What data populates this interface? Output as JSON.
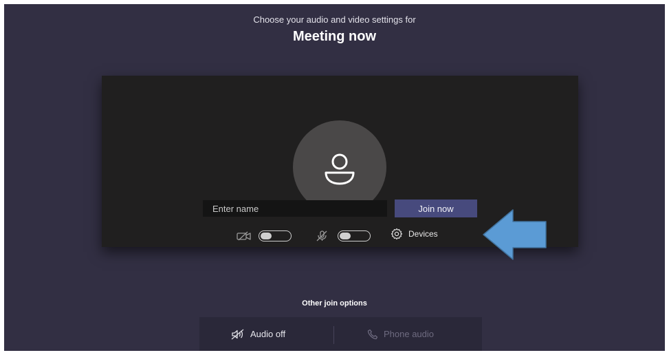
{
  "header": {
    "subtitle": "Choose your audio and video settings for",
    "title": "Meeting now"
  },
  "prejoin": {
    "name_placeholder": "Enter name",
    "join_label": "Join now",
    "camera_icon": "camera-off-icon",
    "camera_toggle_on": false,
    "mic_icon": "mic-off-icon",
    "mic_toggle_on": false,
    "devices_icon": "gear-icon",
    "devices_label": "Devices"
  },
  "annotation": {
    "arrow_icon": "left-arrow-icon",
    "arrow_color": "#5b9bd5"
  },
  "other_options": {
    "label": "Other join options",
    "audio_off_icon": "speaker-off-icon",
    "audio_off_label": "Audio off",
    "phone_icon": "phone-icon",
    "phone_label": "Phone audio"
  },
  "colors": {
    "background": "#322f43",
    "preview": "#201f1f",
    "accent": "#474a7d"
  }
}
